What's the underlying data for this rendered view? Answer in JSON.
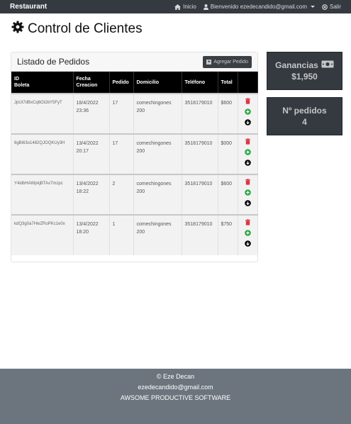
{
  "navbar": {
    "brand": "Restaurant",
    "home_label": "Inicio",
    "user_label": "Bienvenido ezedecandido@gmail.com",
    "logout_label": "Salir"
  },
  "page": {
    "title": "Control de Clientes"
  },
  "orders_card": {
    "title": "Listado de Pedidos",
    "add_button": "Agregar Pedido",
    "columns": {
      "id_line1": "ID",
      "id_line2": "Boleta",
      "date_line1": "Fecha",
      "date_line2": "Creacion",
      "order": "Pedido",
      "address": "Domicilio",
      "phone": "Teléfono",
      "total": "Total"
    },
    "rows": [
      {
        "id": "JpUt7dBxCq6Ot2bY5FyT",
        "date": "18/4/2022",
        "time": "23:36",
        "order": "17",
        "address": "comechingones 200",
        "phone": "3518179010",
        "total": "$600"
      },
      {
        "id": "6gBi63o1482QJOQKUy3H",
        "date": "13/4/2022",
        "time": "20:17",
        "order": "17",
        "address": "comechingones 200",
        "phone": "3518179010",
        "total": "$000"
      },
      {
        "id": "Y4idbHAWpkjBTAx7mzpc",
        "date": "13/4/2022",
        "time": "18:22",
        "order": "2",
        "address": "comechingones 200",
        "phone": "3518179010",
        "total": "$600"
      },
      {
        "id": "kdQ3g0a7HwZRoPKc1e0x",
        "date": "13/4/2022",
        "time": "18:20",
        "order": "1",
        "address": "comechingones 200",
        "phone": "3518179010",
        "total": "$750"
      }
    ]
  },
  "stats": {
    "earnings_label": "Ganancias",
    "earnings_value": "$1,950",
    "orders_label": "Nº pedidos",
    "orders_value": "4"
  },
  "footer": {
    "copyright": "© Eze Decan",
    "email": "ezedecandido@gmail.com",
    "company": "AWSOME PRODUCTIVE SOFTWARE"
  },
  "colors": {
    "navbar": "#343a40",
    "delete_icon": "#dc3545",
    "add_icon": "#28a745",
    "info_icon": "#000000",
    "footer": "#6c757d"
  },
  "icons": [
    "home-icon",
    "user-icon",
    "logout-icon",
    "gear-icon",
    "plus-square-icon",
    "trash-icon",
    "plus-circle-icon",
    "arrow-down-circle-icon",
    "money-icon"
  ]
}
